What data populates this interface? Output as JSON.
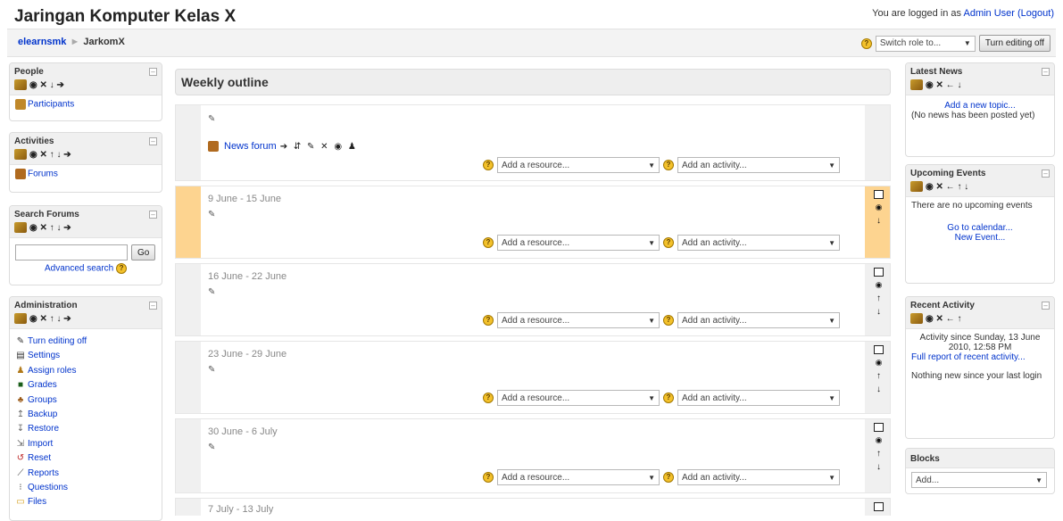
{
  "header": {
    "title": "Jaringan Komputer Kelas X",
    "login_prefix": "You are logged in as ",
    "login_user": "Admin User",
    "logout": "(Logout)"
  },
  "breadcrumb": {
    "home": "elearnsmk",
    "sep": "►",
    "current": "JarkomX"
  },
  "role": {
    "switch_label": "Switch role to...",
    "editing_button": "Turn editing off"
  },
  "blocks": {
    "people": {
      "title": "People",
      "participants": "Participants"
    },
    "activities": {
      "title": "Activities",
      "forums": "Forums"
    },
    "search": {
      "title": "Search Forums",
      "go": "Go",
      "advanced": "Advanced search"
    },
    "admin": {
      "title": "Administration",
      "items": [
        "Turn editing off",
        "Settings",
        "Assign roles",
        "Grades",
        "Groups",
        "Backup",
        "Restore",
        "Import",
        "Reset",
        "Reports",
        "Questions",
        "Files"
      ]
    },
    "news": {
      "title": "Latest News",
      "add_topic": "Add a new topic...",
      "empty": "(No news has been posted yet)"
    },
    "events": {
      "title": "Upcoming Events",
      "empty": "There are no upcoming events",
      "calendar": "Go to calendar...",
      "new_event": "New Event..."
    },
    "recent": {
      "title": "Recent Activity",
      "since": "Activity since Sunday, 13 June 2010, 12:58 PM",
      "full_report": "Full report of recent activity...",
      "nothing": "Nothing new since your last login"
    },
    "blocks": {
      "title": "Blocks",
      "add": "Add..."
    }
  },
  "main": {
    "title": "Weekly outline",
    "news_forum": "News forum",
    "add_resource": "Add a resource...",
    "add_activity": "Add an activity...",
    "weeks": [
      "9 June - 15 June",
      "16 June - 22 June",
      "23 June - 29 June",
      "30 June - 6 July",
      "7 July - 13 July"
    ]
  }
}
